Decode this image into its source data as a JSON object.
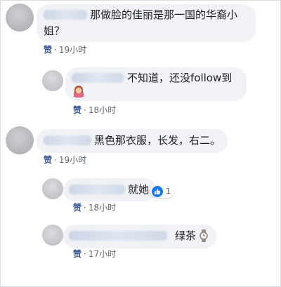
{
  "comments": [
    {
      "text_lines": [
        "那做脸的佳丽是那一国的华裔小",
        "姐？"
      ],
      "like_label": "赞",
      "separator": "·",
      "time": "19小时"
    },
    {
      "text": "不知道，还没follow到",
      "emoji": "woman-gesturing-no-icon",
      "like_label": "赞",
      "separator": "·",
      "time": "18小时"
    },
    {
      "text": "黑色那衣服，长发，右二。",
      "like_label": "赞",
      "separator": "·",
      "time": "19小时"
    },
    {
      "text": "就她",
      "reaction_icon": "thumbs-up-icon",
      "reaction_count": "1",
      "like_label": "赞",
      "separator": "·",
      "time": "18小时"
    },
    {
      "text": "绿茶",
      "emoji": "watch-icon",
      "like_label": "赞",
      "separator": "·",
      "time": "17小时"
    }
  ],
  "colors": {
    "bubble": "#f0f2f5",
    "link": "#385898",
    "meta": "#606770",
    "like_blue": "#1877f2"
  }
}
